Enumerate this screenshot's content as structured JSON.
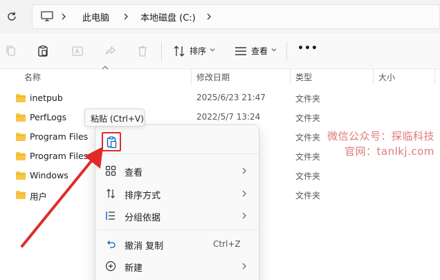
{
  "address": {
    "crumbs": [
      "此电脑",
      "本地磁盘 (C:)"
    ]
  },
  "toolbar": {
    "sort_label": "排序",
    "view_label": "查看",
    "more_label": "•••"
  },
  "columns": [
    "名称",
    "修改日期",
    "类型",
    "大小"
  ],
  "rows": [
    {
      "name": "inetpub",
      "date": "2025/6/23 21:47",
      "type": "文件夹"
    },
    {
      "name": "PerfLogs",
      "date": "2022/5/7 13:24",
      "type": "文件夹"
    },
    {
      "name": "Program Files",
      "date": "",
      "type": "文件夹"
    },
    {
      "name": "Program Files (x",
      "date": "",
      "type": "文件夹"
    },
    {
      "name": "Windows",
      "date": "",
      "type": "文件夹"
    },
    {
      "name": "用户",
      "date": "",
      "type": "文件夹"
    }
  ],
  "tooltip": "粘贴 (Ctrl+V)",
  "context_menu": {
    "items": [
      {
        "label": "查看",
        "shortcut": ""
      },
      {
        "label": "排序方式",
        "shortcut": ""
      },
      {
        "label": "分组依据",
        "shortcut": ""
      },
      {
        "label": "撤消 复制",
        "shortcut": "Ctrl+Z"
      },
      {
        "label": "新建",
        "shortcut": ""
      }
    ]
  },
  "watermark": {
    "line1": "微信公众号：探临科技",
    "line2": "官网：tanlkj.com"
  },
  "colors": {
    "folder": "#f8c545",
    "accent": "#005fb8",
    "highlight": "#e02a2a",
    "watermark": "#e07878"
  }
}
